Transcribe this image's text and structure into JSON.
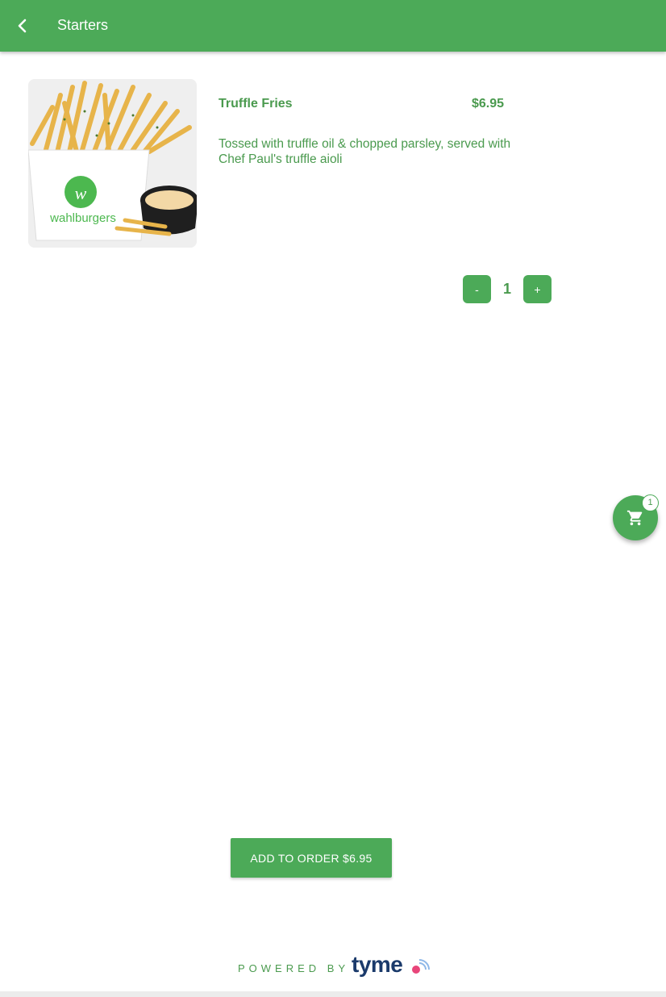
{
  "header": {
    "title": "Starters",
    "back_icon": "chevron-left-icon"
  },
  "item": {
    "name": "Truffle Fries",
    "price": "$6.95",
    "description": "Tossed with truffle oil & chopped parsley, served with Chef Paul's truffle aioli",
    "image_brand_text": "wahlburgers"
  },
  "quantity": {
    "minus_label": "-",
    "value": "1",
    "plus_label": "+"
  },
  "cart": {
    "icon": "cart-icon",
    "badge_count": "1"
  },
  "add_to_order": {
    "label": "ADD TO ORDER $6.95"
  },
  "footer": {
    "powered_by": "POWERED BY",
    "brand": "tyme"
  },
  "colors": {
    "primary": "#4caa58",
    "text_green": "#4a9a4e",
    "brand_navy": "#1b3a6b",
    "brand_pink": "#e8457a"
  }
}
